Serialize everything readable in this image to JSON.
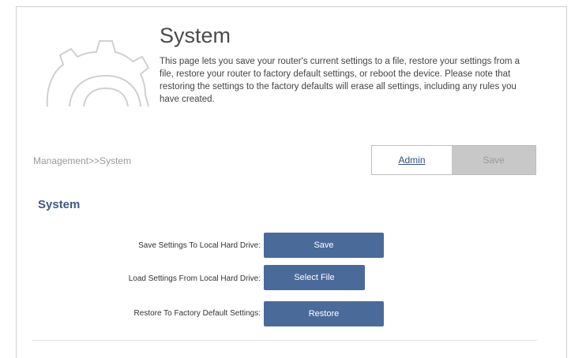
{
  "header": {
    "title": "System",
    "description": "This page lets you save your router's current settings to a file, restore your settings from a file, restore your router to factory default settings, or reboot the device. Please note that restoring the settings to the factory defaults will erase all settings, including any rules you have created.",
    "icon": "gear-icon"
  },
  "breadcrumb": "Management>>System",
  "tabs": {
    "admin_label": "Admin",
    "save_label": "Save"
  },
  "section": {
    "title": "System",
    "rows": [
      {
        "label": "Save Settings To Local Hard Drive:",
        "button": "Save"
      },
      {
        "label": "Load Settings From Local Hard Drive:",
        "button": "Select File"
      },
      {
        "label": "Restore To Factory Default Settings:",
        "button": "Restore"
      }
    ]
  },
  "colors": {
    "button": "#4a6a9a",
    "section_title": "#3d5a80",
    "save_tab_bg": "#c8c8c8"
  }
}
